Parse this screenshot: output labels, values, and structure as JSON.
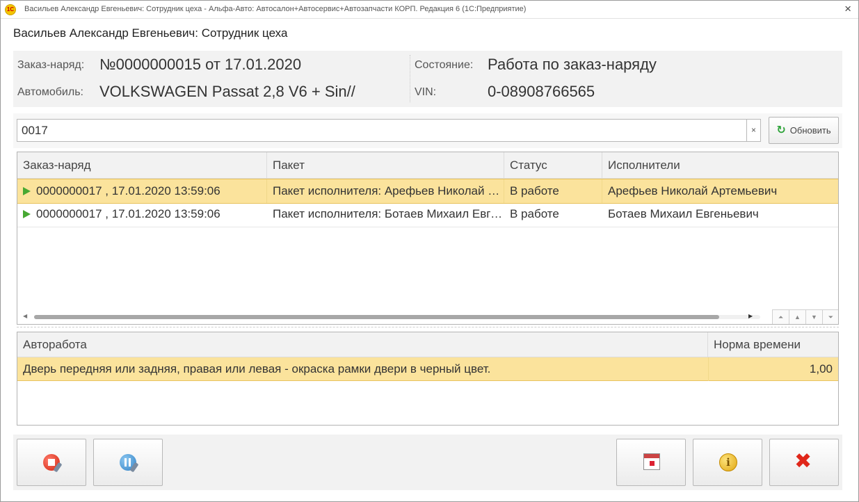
{
  "window": {
    "title": "Васильев Александр Евгеньевич: Сотрудник цеха - Альфа-Авто: Автосалон+Автосервис+Автозапчасти КОРП. Редакция 6  (1С:Предприятие)",
    "app_icon_text": "1С",
    "close_glyph": "×"
  },
  "form": {
    "title": "Васильев Александр Евгеньевич: Сотрудник цеха"
  },
  "order_info": {
    "order_label": "Заказ-наряд:",
    "order_value": "№0000000015  от 17.01.2020",
    "state_label": "Состояние:",
    "state_value": "Работа по заказ-наряду",
    "car_label": "Автомобиль:",
    "car_value": "VOLKSWAGEN Passat 2,8 V6 + Sin//",
    "vin_label": "VIN:",
    "vin_value": "0-08908766565"
  },
  "search": {
    "value": "0017",
    "clear_glyph": "×",
    "refresh_label": "Обновить",
    "refresh_icon": "refresh-icon"
  },
  "orders_table": {
    "columns": [
      "Заказ-наряд",
      "Пакет",
      "Статус",
      "Исполнители"
    ],
    "rows": [
      {
        "order": "0000000017 , 17.01.2020 13:59:06",
        "package": "Пакет исполнителя: Арефьев Николай Артемьевич",
        "status": "В работе",
        "executors": "Арефьев Николай Артемьевич",
        "selected": true
      },
      {
        "order": "0000000017 , 17.01.2020 13:59:06",
        "package": "Пакет исполнителя: Ботаев Михаил Евгеньевич",
        "status": "В работе",
        "executors": "Ботаев Михаил Евгеньевич",
        "selected": false
      }
    ],
    "nav_glyphs": [
      "⏶",
      "▲",
      "▼",
      "⏷"
    ]
  },
  "works_table": {
    "columns": [
      "Авторабота",
      "Норма времени"
    ],
    "rows": [
      {
        "work": "Дверь передняя или задняя, правая или левая - окраска рамки двери в черный цвет.",
        "norm": "1,00"
      }
    ]
  },
  "colors": {
    "selected_row": "#fbe39c",
    "panel_bg": "#f2f2f2",
    "play_icon": "#47a832"
  }
}
